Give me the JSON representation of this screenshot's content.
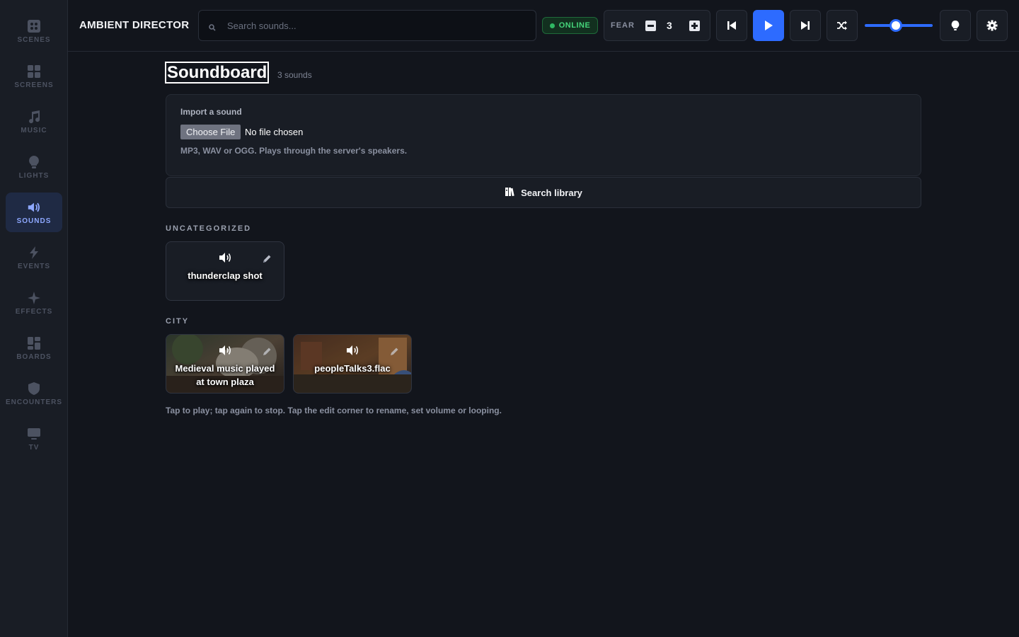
{
  "app": {
    "title": "AMBIENT DIRECTOR"
  },
  "search": {
    "placeholder": "Search sounds..."
  },
  "status": {
    "label": "ONLINE",
    "color": "#45d47a"
  },
  "fear": {
    "label": "FEAR",
    "value": "3"
  },
  "transport": {
    "volume_fraction": 0.45,
    "accent": "#2d6bff"
  },
  "sidebar": {
    "items": [
      {
        "label": "SCENES",
        "icon": "scenes-icon",
        "active": false
      },
      {
        "label": "SCREENS",
        "icon": "screens-icon",
        "active": false
      },
      {
        "label": "MUSIC",
        "icon": "music-icon",
        "active": false
      },
      {
        "label": "LIGHTS",
        "icon": "lightbulb-icon",
        "active": false
      },
      {
        "label": "SOUNDS",
        "icon": "speaker-icon",
        "active": true
      },
      {
        "label": "EVENTS",
        "icon": "bolt-icon",
        "active": false
      },
      {
        "label": "EFFECTS",
        "icon": "sparkle-icon",
        "active": false
      },
      {
        "label": "BOARDS",
        "icon": "boards-icon",
        "active": false
      },
      {
        "label": "ENCOUNTERS",
        "icon": "shield-icon",
        "active": false
      },
      {
        "label": "TV",
        "icon": "tv-icon",
        "active": false
      }
    ]
  },
  "main": {
    "title": "Soundboard",
    "count": "3 sounds",
    "import": {
      "title": "Import a sound",
      "button": "Choose File",
      "status": "No file chosen",
      "hint": "MP3, WAV or OGG. Plays through the server's speakers."
    },
    "library_button": "Search library",
    "sections": [
      {
        "label": "UNCATEGORIZED",
        "sounds": [
          {
            "name": "thunderclap shot"
          }
        ]
      },
      {
        "label": "CITY",
        "sounds": [
          {
            "name": "Medieval music played at town plaza"
          },
          {
            "name": "peopleTalks3.flac"
          }
        ]
      }
    ],
    "footer_hint": "Tap to play; tap again to stop. Tap the edit corner to rename, set volume or looping."
  }
}
